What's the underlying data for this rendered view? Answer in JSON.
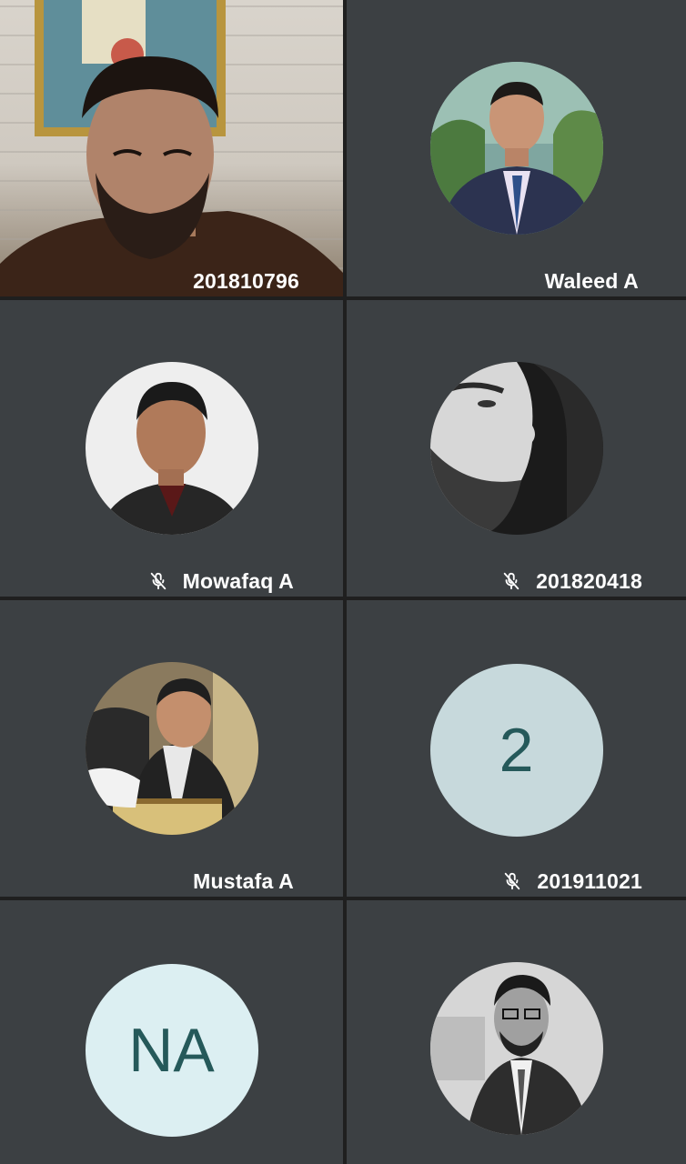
{
  "participants": [
    {
      "name": "201810796",
      "muted": false,
      "type": "video"
    },
    {
      "name": "Waleed A",
      "muted": false,
      "type": "photo"
    },
    {
      "name": "Mowafaq A",
      "muted": true,
      "type": "photo"
    },
    {
      "name": "201820418",
      "muted": true,
      "type": "photo"
    },
    {
      "name": "Mustafa A",
      "muted": false,
      "type": "photo"
    },
    {
      "name": "201911021",
      "muted": true,
      "type": "initials",
      "initials": "2",
      "avatar_color": "#c7d9dc"
    },
    {
      "name": "",
      "muted": false,
      "type": "initials",
      "initials": "NA",
      "avatar_color": "#dceff2"
    },
    {
      "name": "",
      "muted": false,
      "type": "photo"
    }
  ],
  "colors": {
    "tile_background": "#3c4043",
    "grid_gap": "#1f1f1f",
    "name_text": "#ffffff",
    "initials_text": "#25595a"
  },
  "icons": {
    "muted": "mic-off-icon"
  }
}
